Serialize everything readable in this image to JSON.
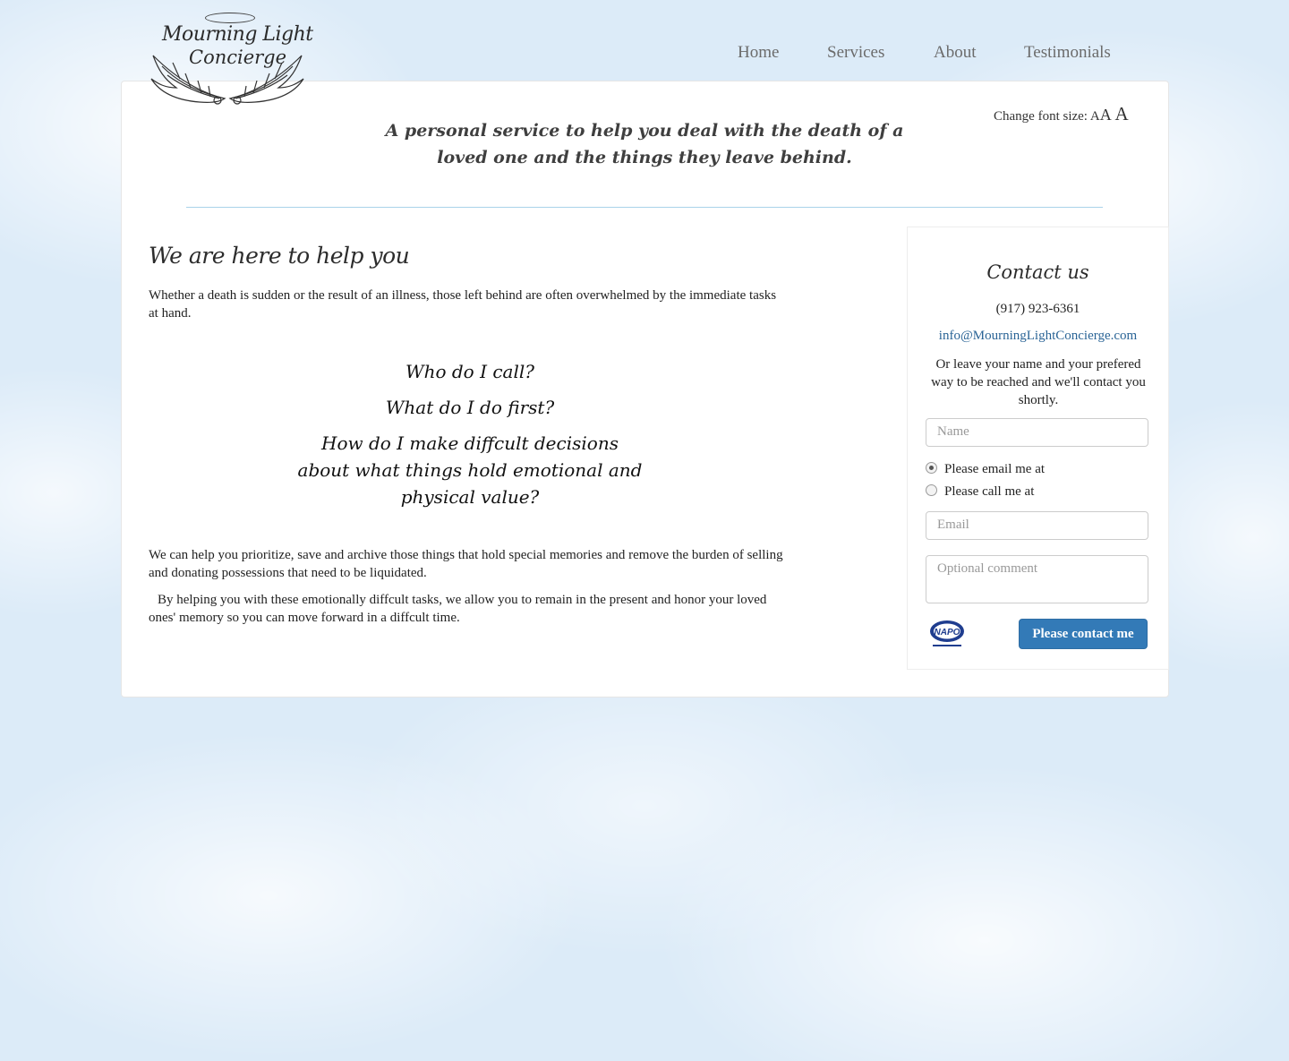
{
  "brand": {
    "logo_line1": "Mourning Light",
    "logo_line2": "Concierge"
  },
  "nav": {
    "items": [
      "Home",
      "Services",
      "About",
      "Testimonials"
    ]
  },
  "font_size": {
    "label": "Change font size:",
    "small": "A",
    "medium": "A",
    "large": "A"
  },
  "tagline": "A personal service to help you deal with the death of a loved one and the things they leave behind.",
  "main": {
    "heading": "We are here to help you",
    "intro": "Whether a death is sudden or the result of an illness, those left behind are often overwhelmed by the immediate tasks at hand.",
    "questions": [
      "Who do I call?",
      "What do I do first?",
      "How do I make diffcult decisions about what things hold emotional and physical value?"
    ],
    "para2": "We can help you prioritize, save and archive those things that hold special memories and remove the burden of selling and donating possessions that need to be liquidated.",
    "para3": "By helping you with these emotionally diffcult tasks, we allow you to remain in the present and honor your loved ones' memory so you can move forward in a diffcult time."
  },
  "contact": {
    "title": "Contact us",
    "phone": "(917) 923-6361",
    "email": "info@MourningLightConcierge.com",
    "blurb": "Or leave your name and your prefered way to be reached and we'll contact you shortly.",
    "name_placeholder": "Name",
    "radio_email": "Please email me at",
    "radio_call": "Please call me at",
    "email_placeholder": "Email",
    "comment_placeholder": "Optional comment",
    "napo_label": "NAPO",
    "submit": "Please contact me"
  },
  "colors": {
    "accent": "#337ab7",
    "link": "#2a6496",
    "divider": "#a9d3ea"
  }
}
